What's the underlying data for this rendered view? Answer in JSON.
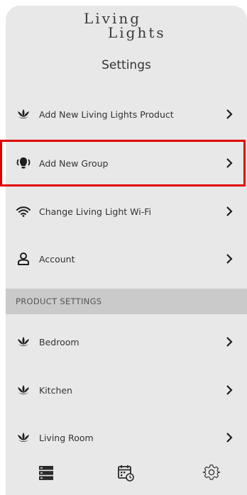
{
  "app": {
    "logo_line1": "Living",
    "logo_line2": "Lights",
    "page_title": "Settings"
  },
  "settings_items": [
    {
      "label": "Add New Living Lights Product",
      "icon": "lotus-icon"
    },
    {
      "label": "Add New Group",
      "icon": "lightbulb-group-icon"
    },
    {
      "label": "Change Living Light Wi-Fi",
      "icon": "wifi-icon"
    },
    {
      "label": "Account",
      "icon": "person-icon"
    }
  ],
  "product_settings": {
    "header": "PRODUCT SETTINGS",
    "items": [
      {
        "label": "Bedroom",
        "icon": "lotus-icon"
      },
      {
        "label": "Kitchen",
        "icon": "lotus-icon"
      },
      {
        "label": "Living Room",
        "icon": "lotus-icon"
      }
    ]
  },
  "tabs": [
    {
      "icon": "server-list-icon"
    },
    {
      "icon": "calendar-clock-icon"
    },
    {
      "icon": "gear-icon"
    }
  ],
  "colors": {
    "background": "#e8e8e8",
    "section_header": "#cacaca",
    "highlight": "#e00000",
    "icon": "#1e1e1e"
  }
}
